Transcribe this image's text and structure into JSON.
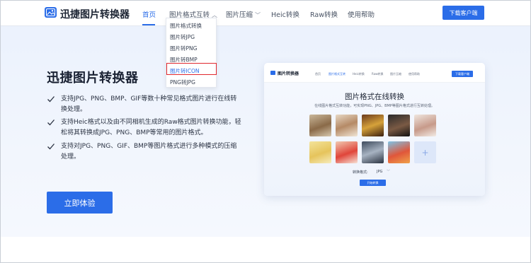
{
  "header": {
    "logo_text": "迅捷图片转换器",
    "nav": [
      {
        "label": "首页",
        "active": true
      },
      {
        "label": "图片格式互转",
        "has_dropdown": true
      },
      {
        "label": "图片压缩",
        "has_dropdown": true
      },
      {
        "label": "Heic转换"
      },
      {
        "label": "Raw转换"
      },
      {
        "label": "使用帮助"
      }
    ],
    "download_label": "下载客户端"
  },
  "dropdown": {
    "items": [
      "图片格式转换",
      "图片转JPG",
      "图片转PNG",
      "图片转BMP",
      "图片转ICON",
      "PNG转JPG"
    ],
    "highlighted_index": 4
  },
  "hero": {
    "title": "迅捷图片转换器",
    "features": [
      "支持JPG、PNG、BMP、GIF等数十种常见格式图片进行在线转换处理。",
      "支持Heic格式以及由不同相机生成的Raw格式图片转换功能，轻松将其转换成JPG、PNG、BMP等常用的图片格式。",
      "支持对JPG、PNG、GIF、BMP等图片格式进行多种模式的压缩处理。"
    ],
    "cta_label": "立即体验"
  },
  "preview": {
    "logo_text": "图片转换器",
    "nav": [
      "首页",
      "图片格式互转",
      "Heic转换",
      "Raw转换",
      "图片压缩",
      "使用帮助"
    ],
    "download_label": "下载客户端",
    "title": "图片格式在线转换",
    "subtitle": "在线图片格式互转功能，可实现PNG、JPG、BMP等图片格式进行互转处理。",
    "add_symbol": "+",
    "format_label": "转换格式:",
    "format_value": "JPG",
    "start_label": "开始转换"
  },
  "colors": {
    "accent": "#2b6de8",
    "highlight_border": "#e0282e"
  }
}
